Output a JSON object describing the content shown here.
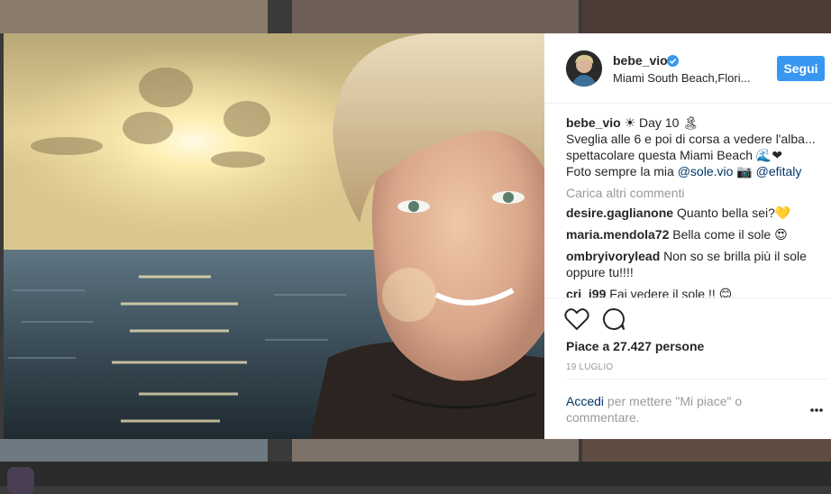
{
  "post": {
    "username": "bebe_vio",
    "location": "Miami South Beach,Flori...",
    "follow_label": "Segui",
    "caption": {
      "user": "bebe_vio",
      "line1": " ☀ Day 10 🏝",
      "line2": "Sveglia alle 6 e poi di corsa a vedere l'alba...",
      "line3": "spettacolare questa Miami Beach 🌊❤",
      "line4_prefix": "Foto sempre la mia ",
      "mention1": "@sole.vio",
      "camera": " 📷 ",
      "mention2": "@efitaly"
    },
    "load_more_label": "Carica altri commenti",
    "comments": [
      {
        "user": "desire.gaglianone",
        "text": "Quanto bella sei?💛"
      },
      {
        "user": "maria.mendola72",
        "text": "Bella come il sole 😍"
      },
      {
        "user": "ombryivorylead",
        "text": "Non so se brilla più il sole oppure tu!!!!"
      },
      {
        "user": "cri_i99",
        "text": "Fai vedere il sole !! 😊"
      }
    ],
    "likes": "Piace a 27.427 persone",
    "date": "19 LUGLIO",
    "login_link": "Accedi",
    "login_rest": " per mettere \"Mi piace\" o commentare."
  },
  "colors": {
    "accent": "#3897f0",
    "link": "#003569",
    "muted": "#999999",
    "text": "#262626"
  },
  "icons": {
    "verified": "verified-badge-icon",
    "like": "heart-icon",
    "comment": "comment-bubble-icon",
    "more": "more-dots-icon"
  }
}
